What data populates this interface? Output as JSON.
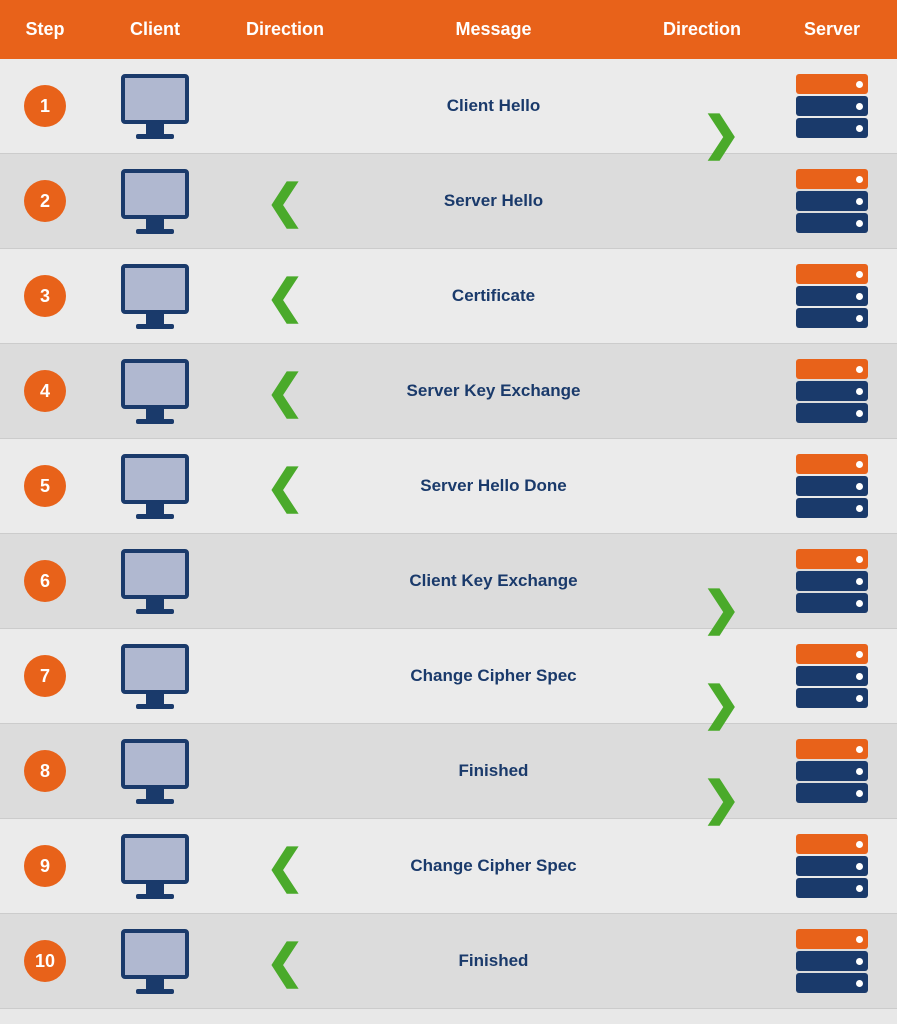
{
  "header": {
    "columns": [
      "Step",
      "Client",
      "Direction",
      "Message",
      "Direction",
      "Server"
    ]
  },
  "rows": [
    {
      "step": "1",
      "direction_left": false,
      "direction_right": true,
      "message": "Client Hello",
      "dir_col": "right"
    },
    {
      "step": "2",
      "direction_left": true,
      "direction_right": false,
      "message": "Server Hello",
      "dir_col": "left"
    },
    {
      "step": "3",
      "direction_left": true,
      "direction_right": false,
      "message": "Certificate",
      "dir_col": "left"
    },
    {
      "step": "4",
      "direction_left": true,
      "direction_right": false,
      "message": "Server Key Exchange",
      "dir_col": "left"
    },
    {
      "step": "5",
      "direction_left": true,
      "direction_right": false,
      "message": "Server Hello Done",
      "dir_col": "left"
    },
    {
      "step": "6",
      "direction_left": false,
      "direction_right": true,
      "message": "Client Key Exchange",
      "dir_col": "right"
    },
    {
      "step": "7",
      "direction_left": false,
      "direction_right": true,
      "message": "Change Cipher Spec",
      "dir_col": "right"
    },
    {
      "step": "8",
      "direction_left": false,
      "direction_right": true,
      "message": "Finished",
      "dir_col": "right"
    },
    {
      "step": "9",
      "direction_left": true,
      "direction_right": false,
      "message": "Change Cipher Spec",
      "dir_col": "left"
    },
    {
      "step": "10",
      "direction_left": true,
      "direction_right": false,
      "message": "Finished",
      "dir_col": "left"
    }
  ]
}
